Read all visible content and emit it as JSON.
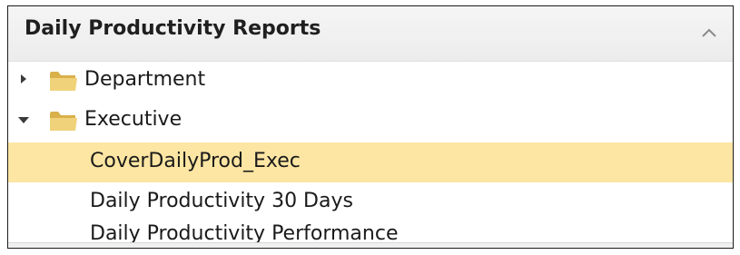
{
  "panel": {
    "title": "Daily Productivity Reports",
    "collapse_icon": "chevron-up-icon"
  },
  "tree": {
    "folders": [
      {
        "label": "Department",
        "expanded": false,
        "icon": "folder-icon"
      },
      {
        "label": "Executive",
        "expanded": true,
        "icon": "folder-icon"
      }
    ],
    "reports": [
      {
        "label": "CoverDailyProd_Exec",
        "selected": true
      },
      {
        "label": "Daily Productivity 30 Days",
        "selected": false
      },
      {
        "label": "Daily Productivity Performance",
        "selected": false
      }
    ]
  },
  "colors": {
    "selection": "#fde6a3",
    "folder": "#e9c86b",
    "border": "#1c1c1c"
  }
}
